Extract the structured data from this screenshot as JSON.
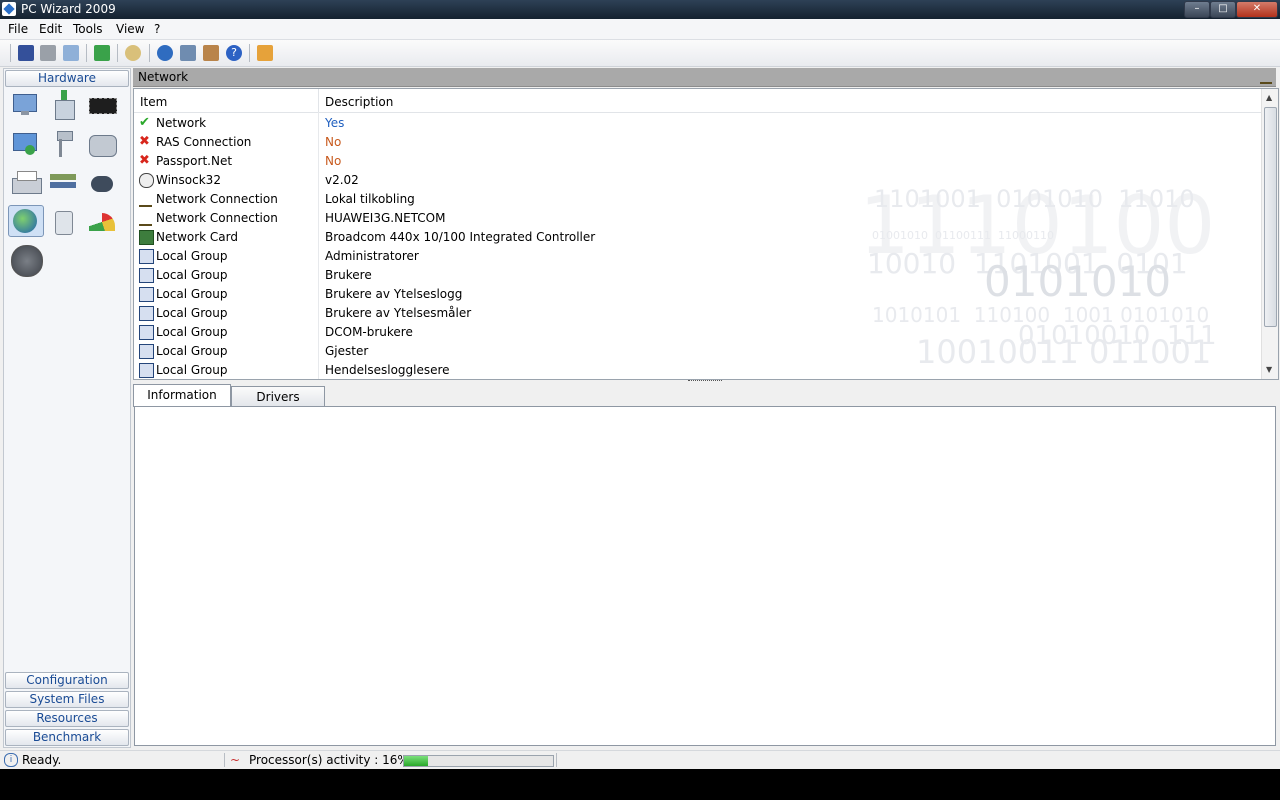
{
  "window": {
    "title": "PC Wizard 2009"
  },
  "menu": [
    "File",
    "Edit",
    "Tools",
    "View",
    "?"
  ],
  "sidebar": {
    "active_section": "Hardware",
    "sections": [
      "Configuration",
      "System Files",
      "Resources",
      "Benchmark"
    ]
  },
  "panel": {
    "title": "Network"
  },
  "list": {
    "columns": [
      "Item",
      "Description"
    ],
    "rows": [
      {
        "item": "Network",
        "desc": "Yes",
        "icon": "check-icon",
        "desc_color": "#1f5fbf"
      },
      {
        "item": "RAS Connection",
        "desc": "No",
        "icon": "cross-icon",
        "desc_color": "#c85a1e"
      },
      {
        "item": "Passport.Net",
        "desc": "No",
        "icon": "cross-icon",
        "desc_color": "#c85a1e"
      },
      {
        "item": "Winsock32",
        "desc": "v2.02",
        "icon": "winsock-icon",
        "desc_color": "#000000"
      },
      {
        "item": "Network Connection",
        "desc": "Lokal tilkobling",
        "icon": "network-connection-icon",
        "desc_color": "#000000"
      },
      {
        "item": "Network Connection",
        "desc": "HUAWEI3G.NETCOM",
        "icon": "network-connection-icon",
        "desc_color": "#000000"
      },
      {
        "item": "Network Card",
        "desc": "Broadcom 440x 10/100 Integrated Controller",
        "icon": "network-card-icon",
        "desc_color": "#000000"
      },
      {
        "item": "Local Group",
        "desc": "Administratorer",
        "icon": "local-group-icon",
        "desc_color": "#000000"
      },
      {
        "item": "Local Group",
        "desc": "Brukere",
        "icon": "local-group-icon",
        "desc_color": "#000000"
      },
      {
        "item": "Local Group",
        "desc": "Brukere av Ytelseslogg",
        "icon": "local-group-icon",
        "desc_color": "#000000"
      },
      {
        "item": "Local Group",
        "desc": "Brukere av Ytelsesmåler",
        "icon": "local-group-icon",
        "desc_color": "#000000"
      },
      {
        "item": "Local Group",
        "desc": "DCOM-brukere",
        "icon": "local-group-icon",
        "desc_color": "#000000"
      },
      {
        "item": "Local Group",
        "desc": "Gjester",
        "icon": "local-group-icon",
        "desc_color": "#000000"
      },
      {
        "item": "Local Group",
        "desc": "Hendelsesloggleser​e",
        "icon": "local-group-icon",
        "desc_color": "#000000"
      }
    ]
  },
  "tabs": [
    "Information",
    "Drivers"
  ],
  "status": {
    "text": "Ready.",
    "activity_label": "Processor(s) activity : 16%",
    "activity_fraction": 0.16
  },
  "colors": {
    "link": "#1f5fbf",
    "negative": "#c85a1e",
    "panel_header": "#a9a9a9",
    "nav_text": "#1a4b95"
  }
}
